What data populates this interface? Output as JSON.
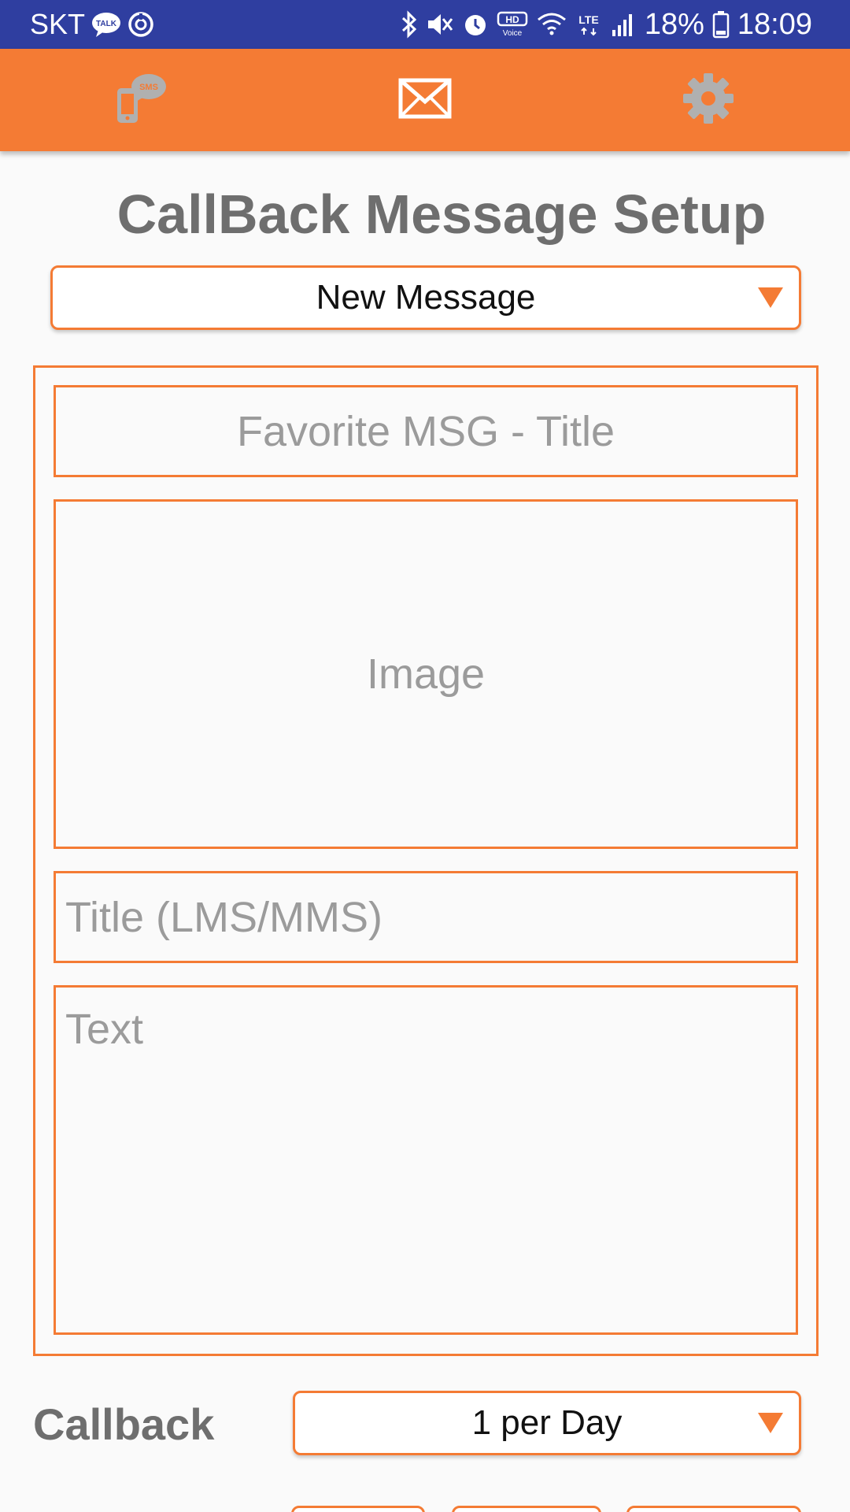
{
  "status_bar": {
    "carrier": "SKT",
    "battery": "18%",
    "time": "18:09",
    "network": "LTE",
    "hd_voice": "HD",
    "hd_voice_sub": "Voice",
    "talk_badge": "TALK",
    "icons": [
      "talk-icon",
      "sync-icon",
      "bluetooth-icon",
      "mute-icon",
      "alarm-icon",
      "hd-voice-icon",
      "wifi-icon",
      "lte-icon",
      "signal-icon",
      "battery-icon"
    ]
  },
  "toolbar": {
    "sms_tab_badge": "SMS",
    "icons": [
      "sms-phone-icon",
      "mail-icon",
      "gear-icon"
    ],
    "color": "#f47b34"
  },
  "page": {
    "title": "CallBack Message Setup",
    "message_select": {
      "value": "New Message"
    },
    "favorite_title_placeholder": "Favorite MSG - Title",
    "image_placeholder": "Image",
    "title_placeholder": "Title (LMS/MMS)",
    "text_placeholder": "Text",
    "callback_label": "Callback",
    "callback_select": {
      "value": "1 per Day"
    }
  },
  "colors": {
    "status_bar": "#2f3ea0",
    "accent": "#f47b34",
    "placeholder_text": "#9b9b9b",
    "label_text": "#6e6e6e"
  }
}
